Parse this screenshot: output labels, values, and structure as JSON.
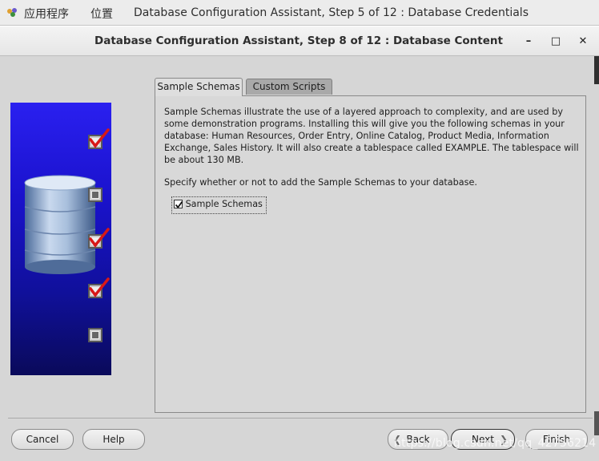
{
  "top_panel": {
    "applications": "应用程序",
    "places": "位置",
    "window_title": "Database Configuration Assistant, Step 5 of 12 : Database Credentials"
  },
  "dialog": {
    "title": "Database Configuration Assistant, Step 8 of 12 : Database Content",
    "minimize": "–",
    "maximize": "□",
    "close": "✕"
  },
  "steps_image": {
    "checkboxes": [
      {
        "checked": true
      },
      {
        "checked": false
      },
      {
        "checked": true
      },
      {
        "checked": true
      },
      {
        "checked": false
      }
    ]
  },
  "tabs": [
    {
      "label": "Sample Schemas",
      "active": true
    },
    {
      "label": "Custom Scripts",
      "active": false
    }
  ],
  "sample_schemas": {
    "description": "Sample Schemas illustrate the use of a layered approach to complexity, and are used by some demonstration programs. Installing this will give you the following schemas in your database: Human Resources, Order Entry, Online Catalog, Product Media, Information Exchange, Sales History. It will also create a tablespace called EXAMPLE. The tablespace will be about 130 MB.",
    "prompt": "Specify whether or not to add the Sample Schemas to your database.",
    "checkbox_label": "Sample Schemas",
    "checkbox_checked": true
  },
  "buttons": {
    "cancel": "Cancel",
    "help": "Help",
    "back": "Back",
    "next": "Next",
    "finish": "Finish"
  },
  "watermark": "https://blog.csdn.net/qq_42756214",
  "colors": {
    "image_top": "#2a20f0",
    "image_bottom": "#0a0a5a",
    "check_red": "#d81818"
  }
}
